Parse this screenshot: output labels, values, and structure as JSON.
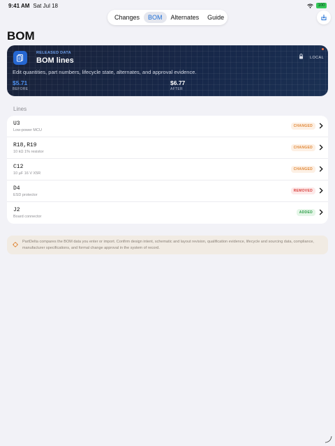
{
  "status": {
    "time": "9:41 AM",
    "date": "Sat Jul 18",
    "battery": "100"
  },
  "tabs": [
    {
      "label": "Changes",
      "active": false
    },
    {
      "label": "BOM",
      "active": true
    },
    {
      "label": "Alternates",
      "active": false
    },
    {
      "label": "Guide",
      "active": false
    }
  ],
  "page": {
    "title": "BOM"
  },
  "hero": {
    "eyebrow": "RELEASED DATA",
    "heading": "BOM lines",
    "mode": "LOCAL",
    "description": "Edit quantities, part numbers, lifecycle state, alternates, and approval evidence.",
    "before_value": "$5.71",
    "before_label": "BEFORE",
    "after_value": "$6.77",
    "after_label": "AFTER"
  },
  "section": {
    "label": "Lines"
  },
  "lines": [
    {
      "ref": "U3",
      "desc": "Low-power MCU",
      "status": "CHANGED",
      "kind": "changed"
    },
    {
      "ref": "R18,R19",
      "desc": "10 kΩ 1% resistor",
      "status": "CHANGED",
      "kind": "changed"
    },
    {
      "ref": "C12",
      "desc": "10 µF 16 V X5R",
      "status": "CHANGED",
      "kind": "changed"
    },
    {
      "ref": "D4",
      "desc": "ESD protector",
      "status": "REMOVED",
      "kind": "removed"
    },
    {
      "ref": "J2",
      "desc": "Board connector",
      "status": "ADDED",
      "kind": "added"
    }
  ],
  "note": {
    "text": "PartDelta compares the BOM data you enter or import. Confirm design intent, schematic and layout revision, qualification evidence, lifecycle and sourcing data, compliance, manufacturer specifications, and formal change approval in the system of record."
  },
  "colors": {
    "accent": "#1f6fd6",
    "hero_bg": "#17284a",
    "changed": "#e08a3c",
    "removed": "#d9433f",
    "added": "#2e9d4a"
  },
  "icons": {
    "download": "download-icon",
    "document": "document-icon",
    "lock": "lock-icon",
    "chevron": "chevron-right-icon",
    "note": "crosshair-icon"
  }
}
